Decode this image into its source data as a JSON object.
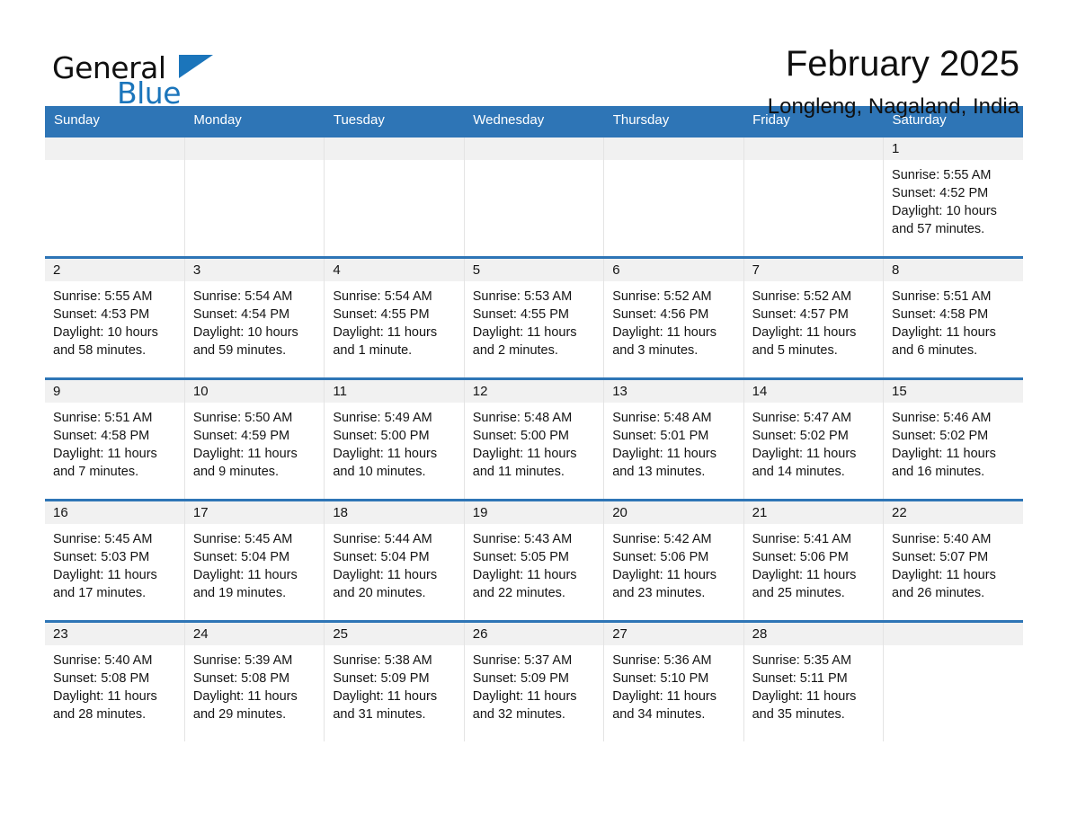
{
  "brand": {
    "name_part1": "General",
    "name_part2": "Blue",
    "accent_color": "#1b75bb"
  },
  "header": {
    "title": "February 2025",
    "subtitle": "Longleng, Nagaland, India"
  },
  "theme": {
    "header_blue": "#2e75b6",
    "band_gray": "#f1f1f1"
  },
  "weekdays": [
    "Sunday",
    "Monday",
    "Tuesday",
    "Wednesday",
    "Thursday",
    "Friday",
    "Saturday"
  ],
  "weeks": [
    [
      {
        "day": ""
      },
      {
        "day": ""
      },
      {
        "day": ""
      },
      {
        "day": ""
      },
      {
        "day": ""
      },
      {
        "day": ""
      },
      {
        "day": "1",
        "sunrise": "Sunrise: 5:55 AM",
        "sunset": "Sunset: 4:52 PM",
        "daylight": "Daylight: 10 hours and 57 minutes."
      }
    ],
    [
      {
        "day": "2",
        "sunrise": "Sunrise: 5:55 AM",
        "sunset": "Sunset: 4:53 PM",
        "daylight": "Daylight: 10 hours and 58 minutes."
      },
      {
        "day": "3",
        "sunrise": "Sunrise: 5:54 AM",
        "sunset": "Sunset: 4:54 PM",
        "daylight": "Daylight: 10 hours and 59 minutes."
      },
      {
        "day": "4",
        "sunrise": "Sunrise: 5:54 AM",
        "sunset": "Sunset: 4:55 PM",
        "daylight": "Daylight: 11 hours and 1 minute."
      },
      {
        "day": "5",
        "sunrise": "Sunrise: 5:53 AM",
        "sunset": "Sunset: 4:55 PM",
        "daylight": "Daylight: 11 hours and 2 minutes."
      },
      {
        "day": "6",
        "sunrise": "Sunrise: 5:52 AM",
        "sunset": "Sunset: 4:56 PM",
        "daylight": "Daylight: 11 hours and 3 minutes."
      },
      {
        "day": "7",
        "sunrise": "Sunrise: 5:52 AM",
        "sunset": "Sunset: 4:57 PM",
        "daylight": "Daylight: 11 hours and 5 minutes."
      },
      {
        "day": "8",
        "sunrise": "Sunrise: 5:51 AM",
        "sunset": "Sunset: 4:58 PM",
        "daylight": "Daylight: 11 hours and 6 minutes."
      }
    ],
    [
      {
        "day": "9",
        "sunrise": "Sunrise: 5:51 AM",
        "sunset": "Sunset: 4:58 PM",
        "daylight": "Daylight: 11 hours and 7 minutes."
      },
      {
        "day": "10",
        "sunrise": "Sunrise: 5:50 AM",
        "sunset": "Sunset: 4:59 PM",
        "daylight": "Daylight: 11 hours and 9 minutes."
      },
      {
        "day": "11",
        "sunrise": "Sunrise: 5:49 AM",
        "sunset": "Sunset: 5:00 PM",
        "daylight": "Daylight: 11 hours and 10 minutes."
      },
      {
        "day": "12",
        "sunrise": "Sunrise: 5:48 AM",
        "sunset": "Sunset: 5:00 PM",
        "daylight": "Daylight: 11 hours and 11 minutes."
      },
      {
        "day": "13",
        "sunrise": "Sunrise: 5:48 AM",
        "sunset": "Sunset: 5:01 PM",
        "daylight": "Daylight: 11 hours and 13 minutes."
      },
      {
        "day": "14",
        "sunrise": "Sunrise: 5:47 AM",
        "sunset": "Sunset: 5:02 PM",
        "daylight": "Daylight: 11 hours and 14 minutes."
      },
      {
        "day": "15",
        "sunrise": "Sunrise: 5:46 AM",
        "sunset": "Sunset: 5:02 PM",
        "daylight": "Daylight: 11 hours and 16 minutes."
      }
    ],
    [
      {
        "day": "16",
        "sunrise": "Sunrise: 5:45 AM",
        "sunset": "Sunset: 5:03 PM",
        "daylight": "Daylight: 11 hours and 17 minutes."
      },
      {
        "day": "17",
        "sunrise": "Sunrise: 5:45 AM",
        "sunset": "Sunset: 5:04 PM",
        "daylight": "Daylight: 11 hours and 19 minutes."
      },
      {
        "day": "18",
        "sunrise": "Sunrise: 5:44 AM",
        "sunset": "Sunset: 5:04 PM",
        "daylight": "Daylight: 11 hours and 20 minutes."
      },
      {
        "day": "19",
        "sunrise": "Sunrise: 5:43 AM",
        "sunset": "Sunset: 5:05 PM",
        "daylight": "Daylight: 11 hours and 22 minutes."
      },
      {
        "day": "20",
        "sunrise": "Sunrise: 5:42 AM",
        "sunset": "Sunset: 5:06 PM",
        "daylight": "Daylight: 11 hours and 23 minutes."
      },
      {
        "day": "21",
        "sunrise": "Sunrise: 5:41 AM",
        "sunset": "Sunset: 5:06 PM",
        "daylight": "Daylight: 11 hours and 25 minutes."
      },
      {
        "day": "22",
        "sunrise": "Sunrise: 5:40 AM",
        "sunset": "Sunset: 5:07 PM",
        "daylight": "Daylight: 11 hours and 26 minutes."
      }
    ],
    [
      {
        "day": "23",
        "sunrise": "Sunrise: 5:40 AM",
        "sunset": "Sunset: 5:08 PM",
        "daylight": "Daylight: 11 hours and 28 minutes."
      },
      {
        "day": "24",
        "sunrise": "Sunrise: 5:39 AM",
        "sunset": "Sunset: 5:08 PM",
        "daylight": "Daylight: 11 hours and 29 minutes."
      },
      {
        "day": "25",
        "sunrise": "Sunrise: 5:38 AM",
        "sunset": "Sunset: 5:09 PM",
        "daylight": "Daylight: 11 hours and 31 minutes."
      },
      {
        "day": "26",
        "sunrise": "Sunrise: 5:37 AM",
        "sunset": "Sunset: 5:09 PM",
        "daylight": "Daylight: 11 hours and 32 minutes."
      },
      {
        "day": "27",
        "sunrise": "Sunrise: 5:36 AM",
        "sunset": "Sunset: 5:10 PM",
        "daylight": "Daylight: 11 hours and 34 minutes."
      },
      {
        "day": "28",
        "sunrise": "Sunrise: 5:35 AM",
        "sunset": "Sunset: 5:11 PM",
        "daylight": "Daylight: 11 hours and 35 minutes."
      },
      {
        "day": ""
      }
    ]
  ]
}
